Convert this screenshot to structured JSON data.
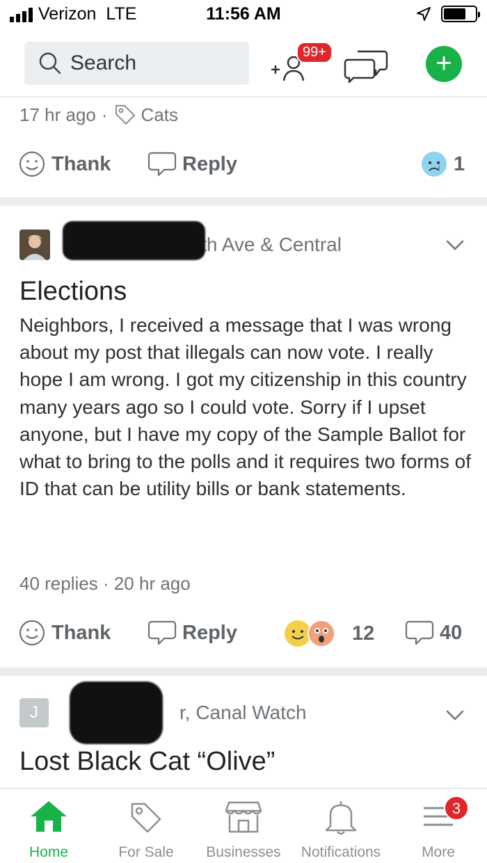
{
  "status_bar": {
    "carrier": "Verizon",
    "network": "LTE",
    "time": "11:56 AM"
  },
  "header": {
    "search_label": "Search",
    "neighbors_badge": "99+"
  },
  "post_prev": {
    "time": "17 hr ago",
    "separator": "·",
    "category": "Cats",
    "thank_label": "Thank",
    "reply_label": "Reply",
    "reaction_count": "1"
  },
  "post_main": {
    "author_suffix": ", 7th Ave & Central",
    "title": "Elections",
    "body": "Neighbors, I received a message that I was wrong about my post that illegals can now vote. I really hope I am wrong. I got my citizenship in this country many years ago so I could vote. Sorry if I upset anyone, but I have my copy of the Sample Ballot for what to bring to the polls and it requires two forms of ID that can be utility bills or bank statements.",
    "replies_meta": "40 replies · 20 hr ago",
    "thank_label": "Thank",
    "reply_label": "Reply",
    "reaction_count": "12",
    "comment_count": "40"
  },
  "post_next": {
    "avatar_letter": "J",
    "author_suffix": "r, Canal Watch",
    "title": "Lost Black Cat “Olive”"
  },
  "tabs": [
    {
      "label": "Home",
      "icon": "home-icon",
      "active": true
    },
    {
      "label": "For Sale",
      "icon": "tag-icon",
      "active": false
    },
    {
      "label": "Businesses",
      "icon": "storefront-icon",
      "active": false
    },
    {
      "label": "Notifications",
      "icon": "bell-icon",
      "active": false
    },
    {
      "label": "More",
      "icon": "menu-icon",
      "active": false,
      "badge": "3"
    }
  ],
  "colors": {
    "brand_green": "#19b249",
    "badge_red": "#e0252b",
    "separator_band": "#e9edf0"
  }
}
